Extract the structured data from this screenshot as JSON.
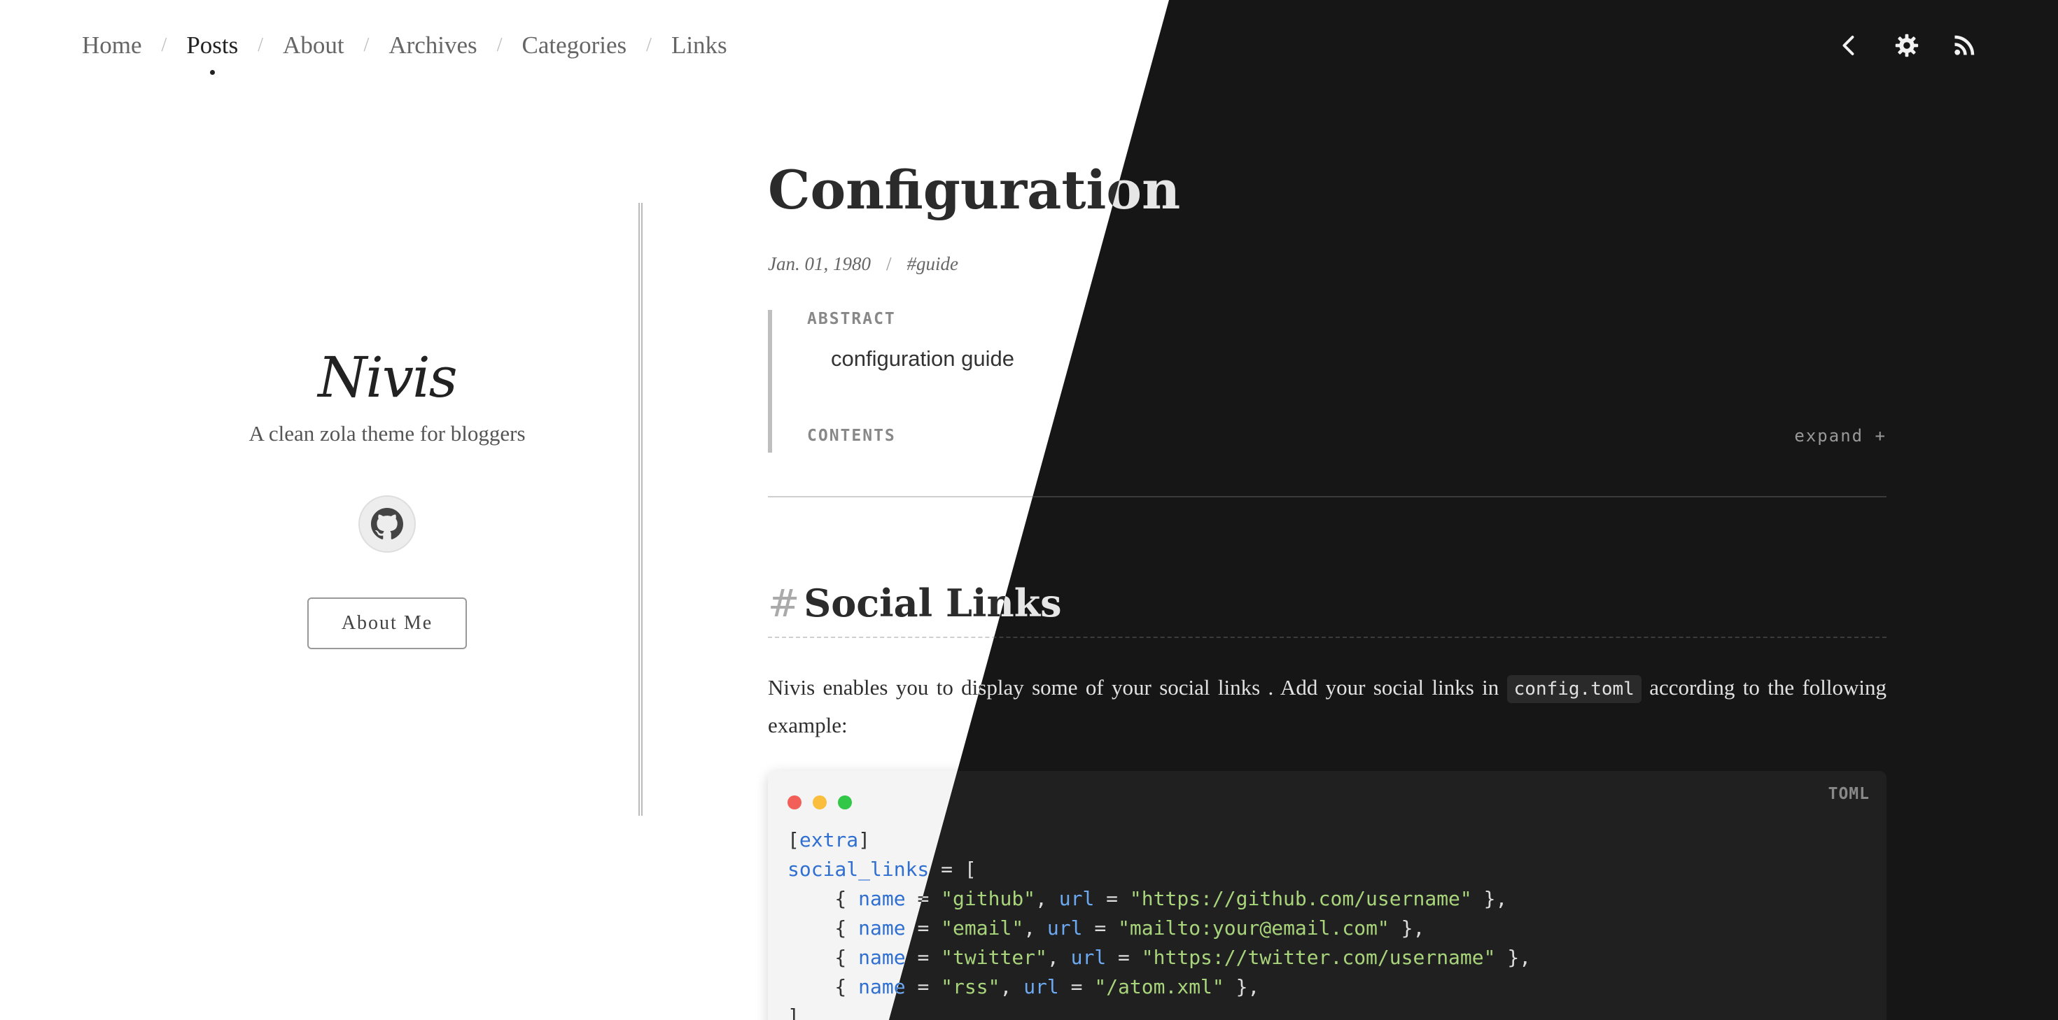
{
  "nav": {
    "items": [
      {
        "label": "Home"
      },
      {
        "label": "Posts",
        "active": true
      },
      {
        "label": "About"
      },
      {
        "label": "Archives"
      },
      {
        "label": "Categories"
      },
      {
        "label": "Links"
      }
    ],
    "separator": "/"
  },
  "top_icons": [
    "chevron-left-icon",
    "gear-icon",
    "rss-icon"
  ],
  "sidebar": {
    "brand": "Nivis",
    "tagline": "A clean zola theme for bloggers",
    "social_icon": "github-icon",
    "about_button": "About Me"
  },
  "post": {
    "title": "Configuration",
    "date": "Jan. 01, 1980",
    "meta_sep": "/",
    "tag": "#guide",
    "abstract_label": "ABSTRACT",
    "abstract_text": "configuration guide",
    "contents_label": "CONTENTS",
    "expand_label": "expand +",
    "section_hash": "#",
    "section_title": "Social Links",
    "para_1": "Nivis enables you to display some of your social links . Add your social links in",
    "inline_code": "config.toml",
    "para_2": "according to the following example:",
    "code_lang": "TOML",
    "code": {
      "l1_open": "[",
      "l1_key": "extra",
      "l1_close": "]",
      "l2_key": "social_links",
      "l2_rest": " = [",
      "lines": [
        {
          "indent": "    { ",
          "nk": "name",
          "eq1": " = ",
          "nv": "\"github\"",
          "comma": ", ",
          "uk": "url",
          "eq2": " = ",
          "uv": "\"https://github.com/username\"",
          "end": " },"
        },
        {
          "indent": "    { ",
          "nk": "name",
          "eq1": " = ",
          "nv": "\"email\"",
          "comma": ", ",
          "uk": "url",
          "eq2": " = ",
          "uv": "\"mailto:your@email.com\"",
          "end": " },"
        },
        {
          "indent": "    { ",
          "nk": "name",
          "eq1": " = ",
          "nv": "\"twitter\"",
          "comma": ", ",
          "uk": "url",
          "eq2": " = ",
          "uv": "\"https://twitter.com/username\"",
          "end": " },"
        },
        {
          "indent": "    { ",
          "nk": "name",
          "eq1": " = ",
          "nv": "\"rss\"",
          "comma": ", ",
          "uk": "url",
          "eq2": " = ",
          "uv": "\"/atom.xml\"",
          "end": " },"
        }
      ],
      "close": "]"
    }
  },
  "colors": {
    "dot_red": "#f25f58",
    "dot_yellow": "#fbbe3c",
    "dot_green": "#33c748",
    "dark_bg": "#161616"
  }
}
